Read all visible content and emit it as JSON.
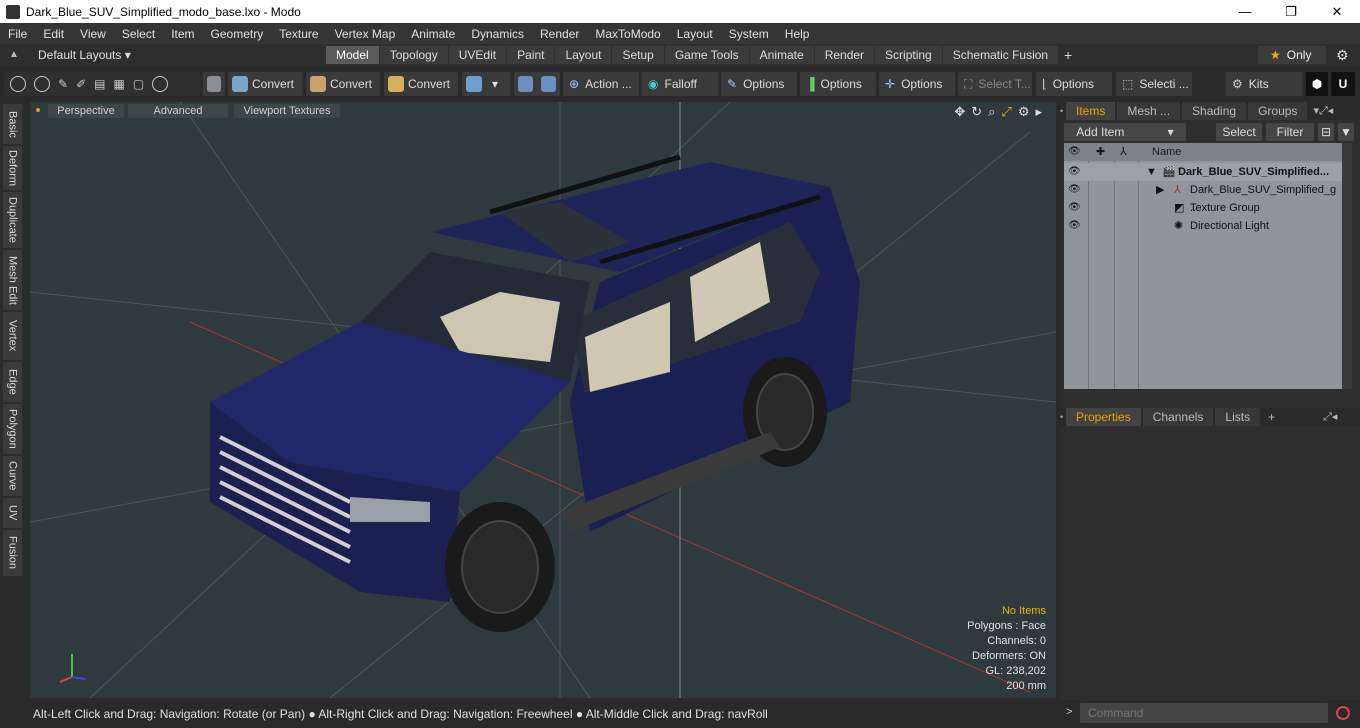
{
  "window": {
    "title": "Dark_Blue_SUV_Simplified_modo_base.lxo - Modo",
    "minimize": "—",
    "maximize": "❐",
    "close": "✕"
  },
  "menu": [
    "File",
    "Edit",
    "View",
    "Select",
    "Item",
    "Geometry",
    "Texture",
    "Vertex Map",
    "Animate",
    "Dynamics",
    "Render",
    "MaxToModo",
    "Layout",
    "System",
    "Help"
  ],
  "layouts_label": "Default Layouts ▾",
  "tabs": [
    "Model",
    "Topology",
    "UVEdit",
    "Paint",
    "Layout",
    "Setup",
    "Game Tools",
    "Animate",
    "Render",
    "Scripting",
    "Schematic Fusion"
  ],
  "active_tab": "Model",
  "only_label": "Only",
  "toolbar": {
    "convert1": "Convert",
    "convert2": "Convert",
    "convert3": "Convert",
    "action": "Action ...",
    "falloff": "Falloff",
    "options1": "Options",
    "options2": "Options",
    "options3": "Options",
    "select_t": "Select T...",
    "options4": "Options",
    "selecti": "Selecti ...",
    "kits": "Kits"
  },
  "left_tabs": [
    "Basic",
    "Deform",
    "Duplicate",
    "Mesh Edit",
    "Vertex",
    "Edge",
    "Polygon",
    "Curve",
    "UV",
    "Fusion"
  ],
  "viewport": {
    "perspective": "Perspective",
    "advanced": "Advanced",
    "textures": "Viewport Textures",
    "info": {
      "no_items": "No Items",
      "polygons": "Polygons : Face",
      "channels": "Channels: 0",
      "deformers": "Deformers: ON",
      "gl": "GL: 238,202",
      "scale": "200 mm"
    }
  },
  "items_panel": {
    "tabs": [
      "Items",
      "Mesh ...",
      "Shading",
      "Groups"
    ],
    "add_item": "Add Item",
    "select": "Select",
    "filter": "Filter",
    "name_header": "Name",
    "rows": [
      "Dark_Blue_SUV_Simplified...",
      "Dark_Blue_SUV_Simplified_g ...",
      "Texture Group",
      "Directional Light"
    ]
  },
  "props_panel": {
    "tabs": [
      "Properties",
      "Channels",
      "Lists"
    ]
  },
  "status": {
    "hint": "Alt-Left Click and Drag: Navigation: Rotate (or Pan) ● Alt-Right Click and Drag: Navigation: Freewheel ● Alt-Middle Click and Drag: navRoll"
  },
  "command": {
    "placeholder": "Command"
  },
  "colors": {
    "suv_body": "#1c2357",
    "viewport_bg": "#2f3a3e",
    "accent": "#f0a000"
  }
}
